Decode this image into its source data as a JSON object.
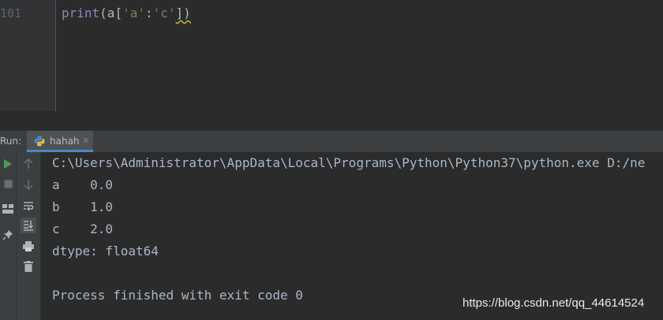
{
  "editor": {
    "line_number": "101",
    "code": {
      "fn": "print",
      "open": "(a[",
      "str1": "'a'",
      "colon": ":",
      "str2": "'c'",
      "close": "])"
    }
  },
  "run_panel": {
    "label": "Run:",
    "tab": {
      "name": "hahah",
      "close": "×"
    }
  },
  "console": {
    "lines": [
      "C:\\Users\\Administrator\\AppData\\Local\\Programs\\Python\\Python37\\python.exe D:/ne",
      "a    0.0",
      "b    1.0",
      "c    2.0",
      "dtype: float64",
      "",
      "Process finished with exit code 0"
    ]
  },
  "watermark": "https://blog.csdn.net/qq_44614524",
  "colors": {
    "background": "#2b2b2b",
    "panel": "#3c3f41",
    "text": "#a9b7c6",
    "function": "#8888c6",
    "string": "#6a8759",
    "run_green": "#499c54",
    "tab_accent": "#4a88c7"
  }
}
